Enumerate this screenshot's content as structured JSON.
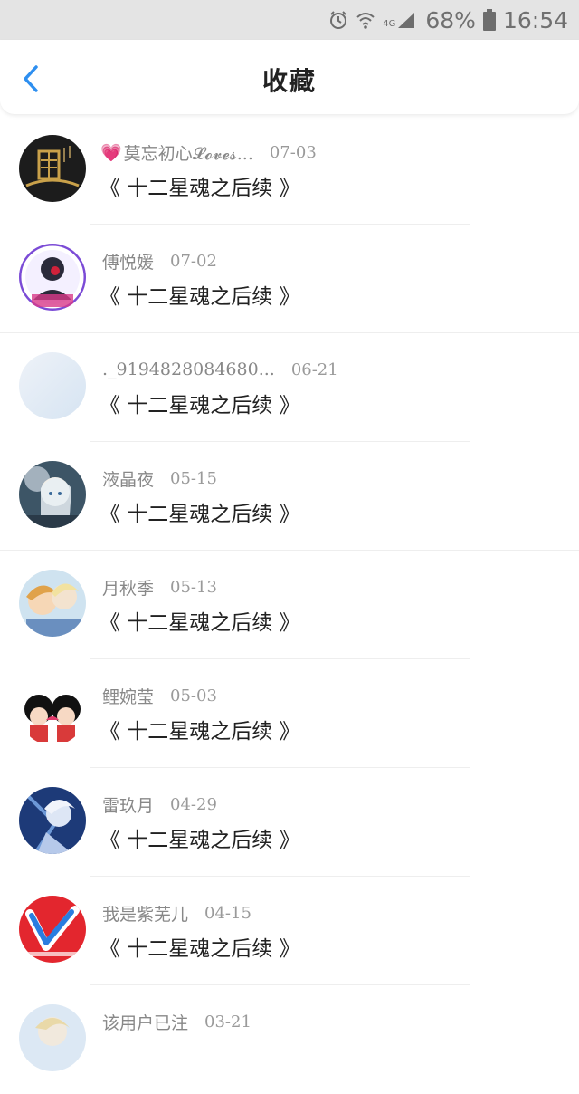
{
  "status_bar": {
    "network": "4G",
    "battery": "68%",
    "time": "16:54",
    "icons": [
      "alarm-icon",
      "wifi-icon",
      "signal-icon",
      "battery-icon"
    ]
  },
  "header": {
    "title": "收藏",
    "back_icon": "chevron-left-icon",
    "accent": "#2e8ff0"
  },
  "items": [
    {
      "heart": "💗",
      "username": "莫忘初心𝓛𝓸𝓿𝓮𝓼...",
      "date": "07-03",
      "title": "《 十二星魂之后续 》"
    },
    {
      "heart": "",
      "username": "傅悦媛",
      "date": "07-02",
      "title": "《 十二星魂之后续 》"
    },
    {
      "heart": "",
      "username": "._9194828084680...",
      "date": "06-21",
      "title": "《 十二星魂之后续 》"
    },
    {
      "heart": "",
      "username": "液晶夜",
      "date": "05-15",
      "title": "《 十二星魂之后续 》"
    },
    {
      "heart": "",
      "username": "月秋季",
      "date": "05-13",
      "title": "《 十二星魂之后续 》"
    },
    {
      "heart": "",
      "username": "鲤婉莹",
      "date": "05-03",
      "title": "《 十二星魂之后续 》"
    },
    {
      "heart": "",
      "username": "雷玖月",
      "date": "04-29",
      "title": "《 十二星魂之后续 》"
    },
    {
      "heart": "",
      "username": "我是紫芜儿",
      "date": "04-15",
      "title": "《 十二星魂之后续 》"
    },
    {
      "heart": "",
      "username": "该用户已注",
      "date": "03-21",
      "title": ""
    }
  ]
}
